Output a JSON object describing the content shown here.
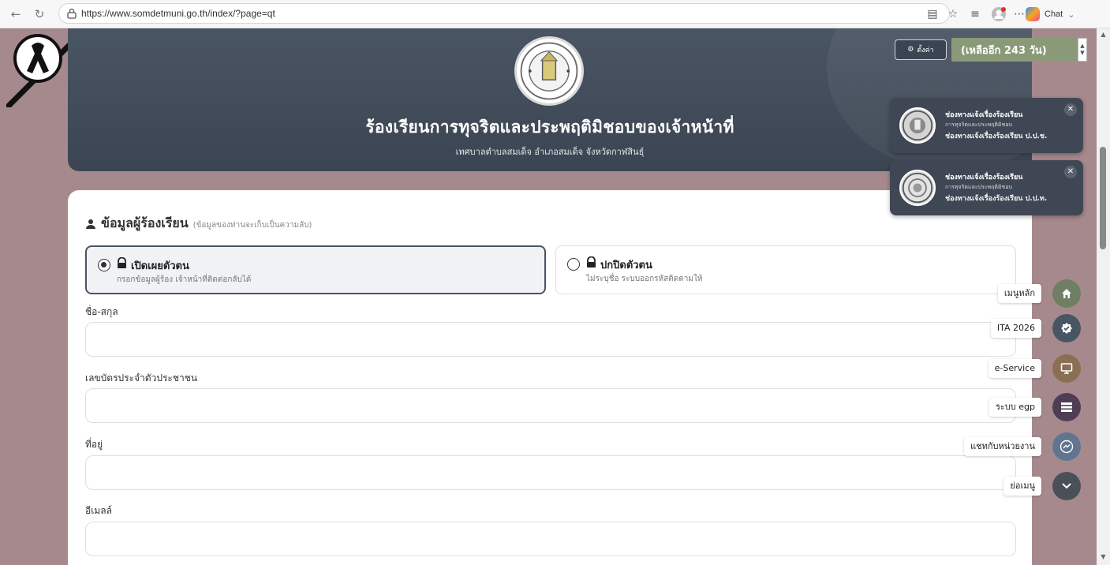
{
  "browser": {
    "url": "https://www.somdetmuni.go.th/index/?page=qt",
    "chat_label": "Chat"
  },
  "header": {
    "title": "ร้องเรียนการทุจริตและประพฤติมิชอบของเจ้าหน้าที่",
    "subtitle": "เทศบาลตำบลสมเด็จ อำเภอสมเด็จ จังหวัดกาฬสินธุ์"
  },
  "settings": {
    "button_label": "ตั้งค่า",
    "days_left": "(เหลืออีก 243 วัน)"
  },
  "notices": [
    {
      "title": "ช่องทางแจ้งเรื่องร้องเรียน",
      "subtitle": "การทุจริตและประพฤติมิชอบ",
      "channel": "ช่องทางแจ้งเรื่องร้องเรียน ป.ป.ช."
    },
    {
      "title": "ช่องทางแจ้งเรื่องร้องเรียน",
      "subtitle": "การทุจริตและประพฤติมิชอบ",
      "channel": "ช่องทางแจ้งเรื่องร้องเรียน ป.ป.ท."
    }
  ],
  "form": {
    "section_title": "ข้อมูลผู้ร้องเรียน",
    "section_note": "(ข้อมูลของท่านจะเก็บเป็นความลับ)",
    "options": [
      {
        "title": "เปิดเผยตัวตน",
        "desc": "กรอกข้อมูลผู้ร้อง เจ้าหน้าที่ติดต่อกลับได้",
        "selected": true
      },
      {
        "title": "ปกปิดตัวตน",
        "desc": "ไม่ระบุชื่อ ระบบออกรหัสติดตามให้",
        "selected": false
      }
    ],
    "fields": [
      {
        "label": "ชื่อ-สกุล",
        "value": ""
      },
      {
        "label": "เลขบัตรประจำตัวประชาชน",
        "value": ""
      },
      {
        "label": "ที่อยู่",
        "value": ""
      },
      {
        "label": "อีเมลล์",
        "value": ""
      }
    ]
  },
  "quick_menu": [
    {
      "label": "เมนูหลัก",
      "icon": "home-icon",
      "color": "#6f7f63"
    },
    {
      "label": "ITA 2026",
      "icon": "badge-check-icon",
      "color": "#4a5563"
    },
    {
      "label": "e-Service",
      "icon": "monitor-icon",
      "color": "#8a6f55"
    },
    {
      "label": "ระบบ egp",
      "icon": "list-icon",
      "color": "#4e3d55"
    },
    {
      "label": "แชทกับหน่วยงาน",
      "icon": "messenger-icon",
      "color": "#5f7590"
    },
    {
      "label": "ย่อเมนู",
      "icon": "chevron-down-icon",
      "color": "#4a5058"
    }
  ]
}
